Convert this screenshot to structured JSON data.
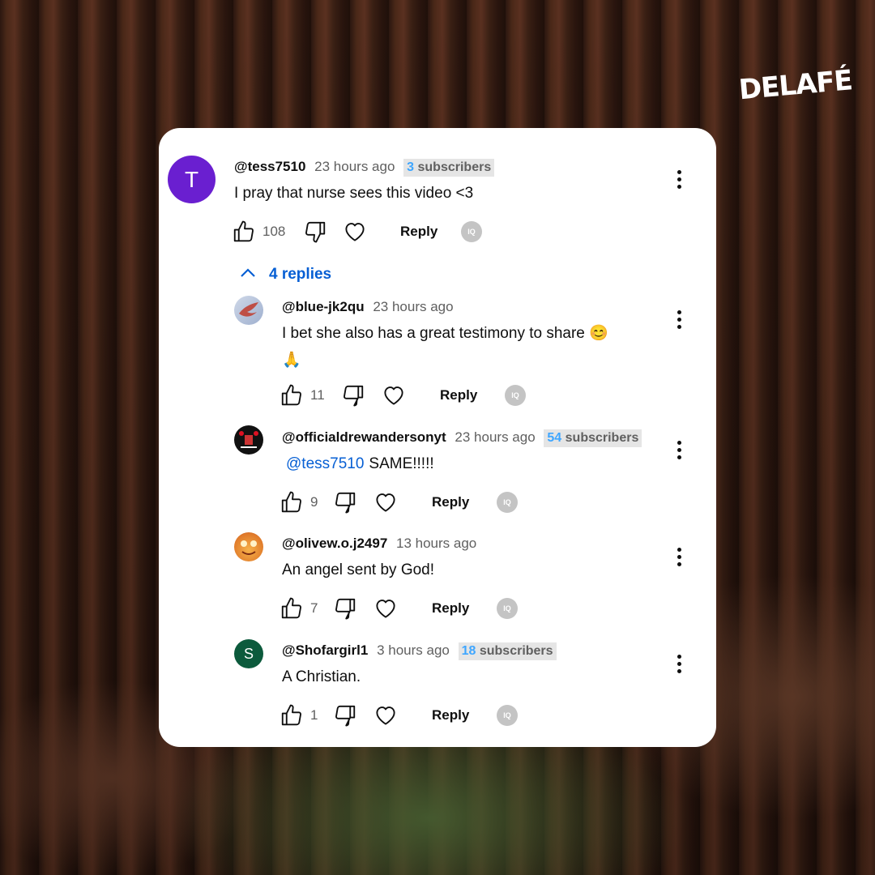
{
  "brand": "DELAFÉ",
  "comment": {
    "avatar_letter": "T",
    "avatar_color": "#6a1fd0",
    "username": "@tess7510",
    "time": "23 hours ago",
    "badge_number": "3",
    "badge_label": "subscribers",
    "text": "I pray that nurse sees this video <3",
    "likes": "108",
    "reply_label": "Reply",
    "iq_label": "IQ"
  },
  "replies_toggle": "4 replies",
  "replies": [
    {
      "username": "@blue-jk2qu",
      "time": "23 hours ago",
      "text_line1": "I bet she also has a great testimony to share 😊",
      "text_line2": "🙏",
      "likes": "11",
      "reply_label": "Reply",
      "iq_label": "IQ"
    },
    {
      "username": "@officialdrewandersonyt",
      "time": "23 hours ago",
      "badge_number": "54",
      "badge_label": "subscribers",
      "mention": "@tess7510",
      "text": "SAME!!!!!",
      "likes": "9",
      "reply_label": "Reply",
      "iq_label": "IQ"
    },
    {
      "username": "@olivew.o.j2497",
      "time": "13 hours ago",
      "text": "An angel sent by God!",
      "likes": "7",
      "reply_label": "Reply",
      "iq_label": "IQ"
    },
    {
      "avatar_letter": "S",
      "avatar_color": "#0c5a3c",
      "username": "@Shofargirl1",
      "time": "3 hours ago",
      "badge_number": "18",
      "badge_label": "subscribers",
      "text": "A Christian.",
      "likes": "1",
      "reply_label": "Reply",
      "iq_label": "IQ"
    }
  ]
}
